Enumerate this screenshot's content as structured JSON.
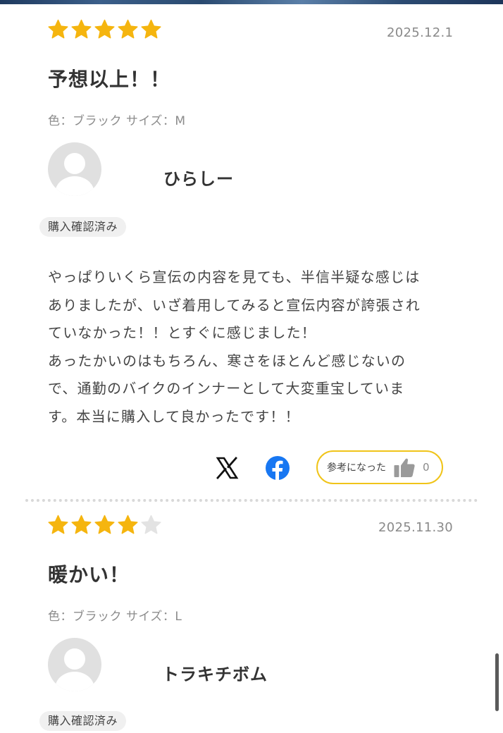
{
  "reviews": [
    {
      "rating": 5,
      "max_rating": 5,
      "date": "2025.12.1",
      "title": "予想以上！！",
      "variant": "色：ブラック サイズ：M",
      "reviewer": "ひらしー",
      "badge": "購入確認済み",
      "body": [
        "やっぱりいくら宣伝の内容を見ても、半信半疑な感じは",
        "ありましたが、いざ着用してみると宣伝内容が誇張され",
        "ていなかった！！とすぐに感じました！",
        "あったかいのはもちろん、寒さをほとんど感じないの",
        "で、通勤のバイクのインナーとして大変重宝していま",
        "す。本当に購入して良かったです！！"
      ],
      "helpful_label": "参考になった",
      "helpful_count": "0"
    },
    {
      "rating": 4,
      "max_rating": 5,
      "date": "2025.11.30",
      "title": "暖かい！",
      "variant": "色：ブラック サイズ：L",
      "reviewer": "トラキチボム",
      "badge": "購入確認済み"
    }
  ],
  "share": {
    "x_icon": "x-logo-icon",
    "facebook_icon": "facebook-icon"
  },
  "colors": {
    "star_filled": "#F5B50F",
    "star_empty": "#E3E3E3",
    "helpful_border": "#F0C419",
    "facebook_blue": "#1877F2"
  }
}
